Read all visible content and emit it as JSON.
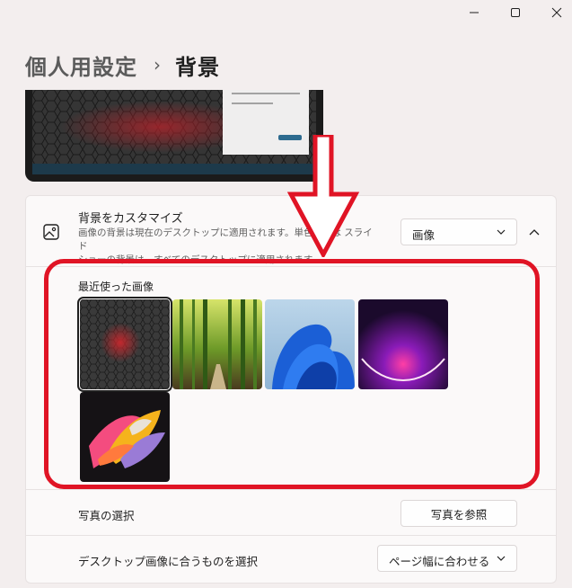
{
  "breadcrumb": {
    "parent": "個人用設定",
    "separator": "›",
    "current": "背景"
  },
  "background_row": {
    "title": "背景をカスタマイズ",
    "description_line1": "画像の背景は現在のデスクトップに適用されます。単色または スライド",
    "description_line2": "ショーの背景は、すべてのデスクトップに適用されます。",
    "dropdown_value": "画像",
    "icon": "image-icon",
    "expanded": true
  },
  "recent": {
    "label": "最近使った画像",
    "images": [
      "hexagon-red-glow",
      "bamboo-forest",
      "blue-bloom",
      "purple-glow",
      "colorful-ribbons"
    ],
    "selected_index": 0
  },
  "photo_row": {
    "label": "写真の選択",
    "button": "写真を参照"
  },
  "fit_row": {
    "label": "デスクトップ画像に合うものを選択",
    "value": "ページ幅に合わせる"
  },
  "colors": {
    "annotation": "#e01425",
    "background": "#f3eeee",
    "card": "#fbf9f9"
  }
}
